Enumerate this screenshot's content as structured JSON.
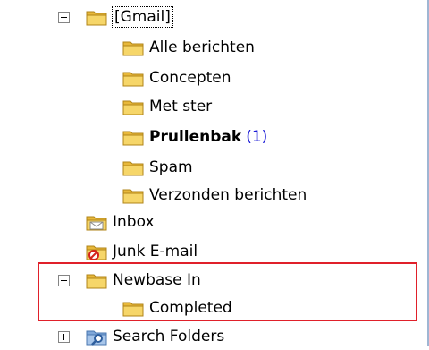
{
  "tree": {
    "gmail": {
      "label": "[Gmail]"
    },
    "alle_berichten": {
      "label": "Alle berichten"
    },
    "concepten": {
      "label": "Concepten"
    },
    "met_ster": {
      "label": "Met ster"
    },
    "prullenbak": {
      "label": "Prullenbak",
      "count": "(1)"
    },
    "spam": {
      "label": "Spam"
    },
    "verzonden": {
      "label": "Verzonden berichten"
    },
    "inbox": {
      "label": "Inbox"
    },
    "junk": {
      "label": "Junk E-mail"
    },
    "newbase_in": {
      "label": "Newbase In"
    },
    "completed": {
      "label": "Completed"
    },
    "search_folders": {
      "label": "Search Folders"
    }
  },
  "colors": {
    "folder": "#f3c84a",
    "highlight_border": "#e0202a",
    "unread_count": "#1a1ad6",
    "pane_border": "#9fb6d3"
  },
  "icons": {
    "folder": "folder-icon",
    "inbox": "inbox-icon",
    "junk": "junk-mail-icon",
    "search_folders": "search-folder-icon",
    "expanded": "collapse-icon",
    "collapsed": "expand-icon"
  }
}
